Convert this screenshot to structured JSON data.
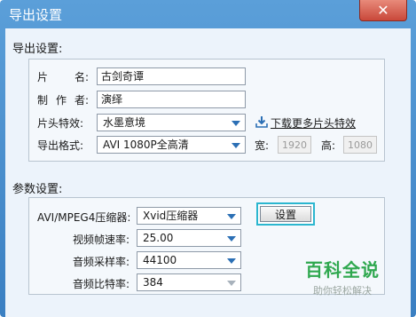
{
  "window": {
    "title": "导出设置",
    "close_glyph": "✕"
  },
  "export_settings": {
    "group_title": "导出设置:",
    "film_name_label": [
      "片",
      "名:"
    ],
    "film_name_value": "古剑奇谭",
    "producer_label": [
      "制",
      "作",
      "者:"
    ],
    "producer_value": "演绎",
    "intro_effect_label": "片头特效:",
    "intro_effect_value": "水墨意境",
    "download_link": "下载更多片头特效",
    "format_label": "导出格式:",
    "format_value": "AVI 1080P全高清",
    "width_label": "宽:",
    "width_value": "1920",
    "height_label": "高:",
    "height_value": "1080"
  },
  "params": {
    "group_title": "参数设置:",
    "compressor_label": "AVI/MPEG4压缩器:",
    "compressor_value": "Xvid压缩器",
    "settings_button": "设置",
    "framerate_label": "视频帧速率:",
    "framerate_value": "25.00",
    "samplerate_label": "音频采样率:",
    "samplerate_value": "44100",
    "bitrate_label": "音频比特率:",
    "bitrate_value": "384"
  },
  "watermark": {
    "brand": "百科全说",
    "tagline": "助你轻松解决"
  },
  "colors": {
    "titlebar": "#3a7fc2",
    "close_button": "#c9483a",
    "highlight_border": "#2bb6cf",
    "link_icon": "#2b6fb5",
    "watermark_green": "#2fa84f"
  }
}
